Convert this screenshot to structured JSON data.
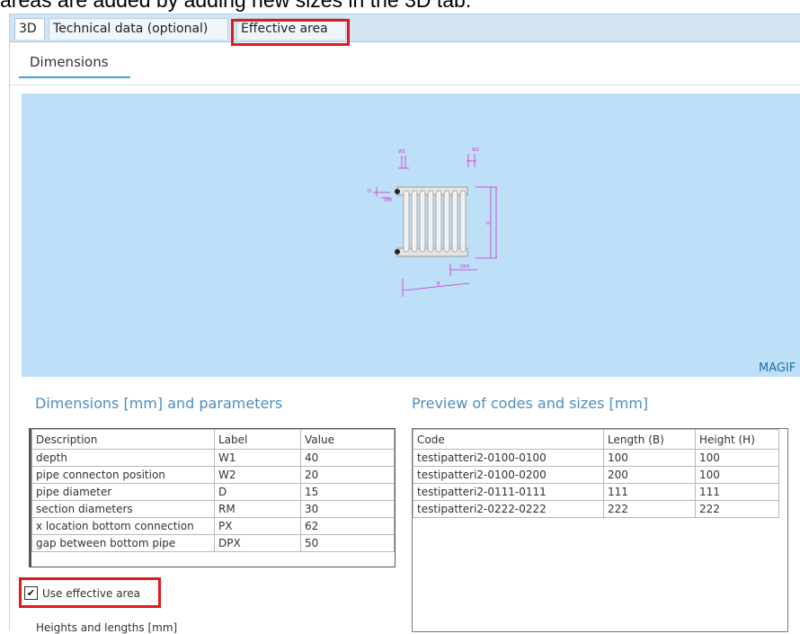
{
  "caption": "areas are added by adding new sizes in the 3D tab.",
  "tabs": [
    {
      "label": "3D",
      "active": true
    },
    {
      "label": "Technical data (optional)",
      "active": false
    },
    {
      "label": "Effective area",
      "active": false
    }
  ],
  "subtab": {
    "label": "Dimensions"
  },
  "viewport": {
    "watermark": "MAGIF",
    "drawing_labels": [
      "W1",
      "W2",
      "D",
      "RM",
      "H",
      "B",
      "DPX"
    ]
  },
  "dimensions": {
    "title": "Dimensions [mm] and parameters",
    "columns": [
      "Description",
      "Label",
      "Value"
    ],
    "rows": [
      [
        "depth",
        "W1",
        "40"
      ],
      [
        "pipe connecton position",
        "W2",
        "20"
      ],
      [
        "pipe diameter",
        "D",
        "15"
      ],
      [
        "section diameters",
        "RM",
        "30"
      ],
      [
        "x location bottom connection",
        "PX",
        "62"
      ],
      [
        "gap between bottom pipe",
        "DPX",
        "50"
      ]
    ]
  },
  "preview": {
    "title": "Preview of codes and sizes [mm]",
    "columns": [
      "Code",
      "Length (B)",
      "Height (H)"
    ],
    "rows": [
      [
        "testipatteri2-0100-0100",
        "100",
        "100"
      ],
      [
        "testipatteri2-0100-0200",
        "200",
        "100"
      ],
      [
        "testipatteri2-0111-0111",
        "111",
        "111"
      ],
      [
        "testipatteri2-0222-0222",
        "222",
        "222"
      ]
    ]
  },
  "use_effective_area": {
    "label": "Use effective area",
    "checked": true,
    "check_glyph": "✔"
  },
  "heights_label": "Heights and lengths [mm]",
  "colors": {
    "highlight": "#e01919",
    "accent": "#3aa0d8",
    "viewport_bg": "#bddff7",
    "section_title": "#4d8ec0"
  }
}
